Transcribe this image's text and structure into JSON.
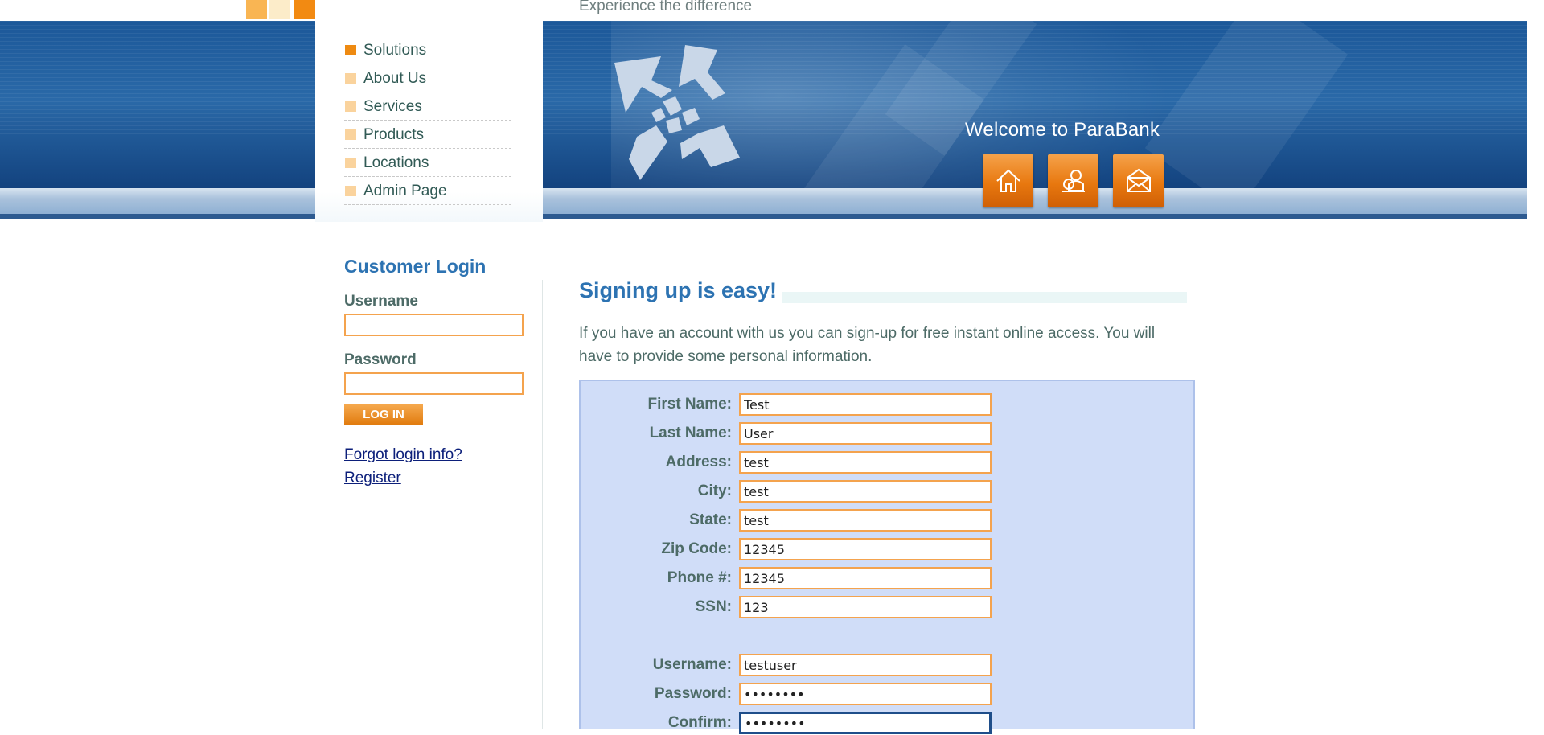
{
  "header": {
    "tagline": "Experience the difference",
    "welcome": "Welcome to ParaBank",
    "icons": [
      "home-icon",
      "about-icon",
      "contact-icon"
    ]
  },
  "nav": {
    "items": [
      {
        "label": "Solutions",
        "active": true
      },
      {
        "label": "About Us"
      },
      {
        "label": "Services"
      },
      {
        "label": "Products"
      },
      {
        "label": "Locations"
      },
      {
        "label": "Admin Page"
      }
    ]
  },
  "login": {
    "title": "Customer Login",
    "username_label": "Username",
    "username_value": "",
    "password_label": "Password",
    "password_value": "",
    "button": "LOG IN",
    "forgot_link": "Forgot login info?",
    "register_link": "Register"
  },
  "main": {
    "title": "Signing up is easy!",
    "intro": "If you have an account with us you can sign-up for free instant online access. You will have to provide some personal information.",
    "fields": {
      "first_name": {
        "label": "First Name:",
        "value": "Test"
      },
      "last_name": {
        "label": "Last Name:",
        "value": "User"
      },
      "address": {
        "label": "Address:",
        "value": "test"
      },
      "city": {
        "label": "City:",
        "value": "test"
      },
      "state": {
        "label": "State:",
        "value": "test"
      },
      "zip": {
        "label": "Zip Code:",
        "value": "12345"
      },
      "phone": {
        "label": "Phone #:",
        "value": "12345"
      },
      "ssn": {
        "label": "SSN:",
        "value": "123"
      },
      "username": {
        "label": "Username:",
        "value": "testuser"
      },
      "password": {
        "label": "Password:",
        "value": "••••••••"
      },
      "confirm": {
        "label": "Confirm:",
        "value": "••••••••"
      }
    }
  },
  "colors": {
    "accent_orange": "#f28a12",
    "header_blue": "#1c5899",
    "title_blue": "#2d73b2",
    "form_bg": "#d0ddf8"
  }
}
